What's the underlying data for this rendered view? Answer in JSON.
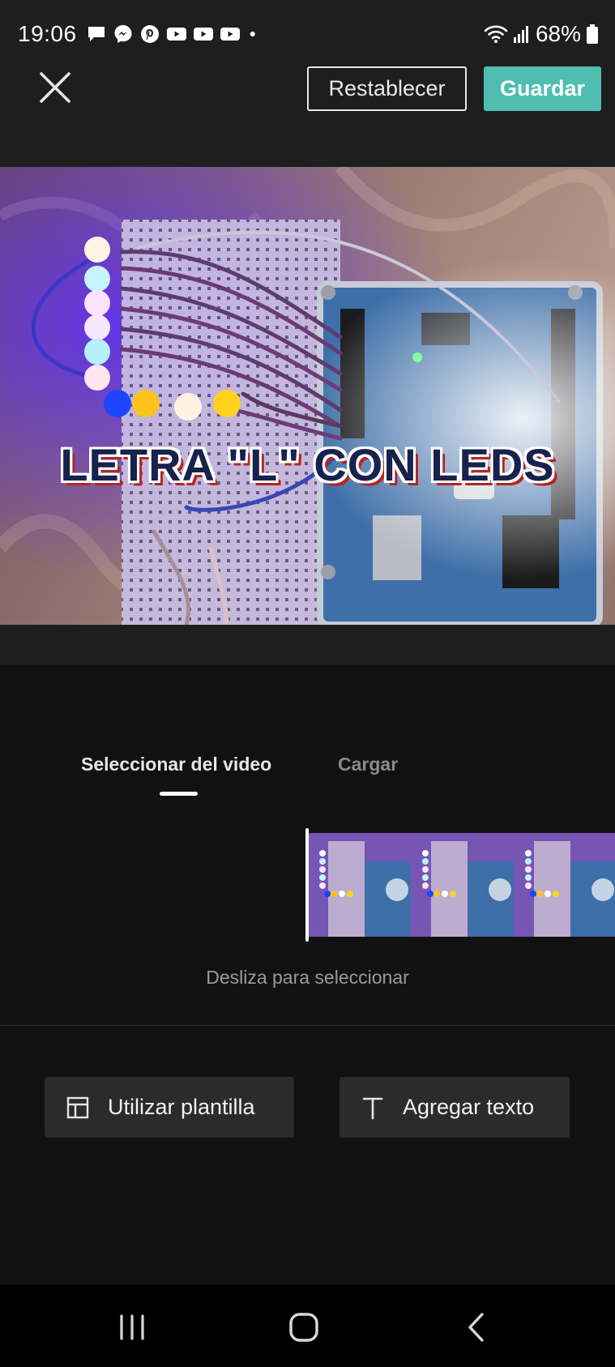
{
  "status_bar": {
    "time": "19:06",
    "battery": "68%",
    "notification_icons": [
      "messages-icon",
      "messenger-icon",
      "pinterest-icon",
      "youtube-icon",
      "youtube-icon",
      "youtube-icon",
      "dot-icon"
    ],
    "status_icons": [
      "wifi-icon",
      "signal-icon",
      "battery-icon"
    ]
  },
  "top_bar": {
    "reset_label": "Restablecer",
    "save_label": "Guardar",
    "accent_color": "#4fbdb0"
  },
  "preview": {
    "overlay_text": "LETRA \"L\" CON LEDS"
  },
  "tabs": [
    {
      "label": "Seleccionar del video",
      "active": true
    },
    {
      "label": "Cargar",
      "active": false
    }
  ],
  "filmstrip": {
    "hint": "Desliza para seleccionar"
  },
  "actions": {
    "template_label": "Utilizar plantilla",
    "text_label": "Agregar texto"
  },
  "nav_bar": {
    "icons": [
      "recent-apps-icon",
      "home-icon",
      "back-icon"
    ]
  }
}
